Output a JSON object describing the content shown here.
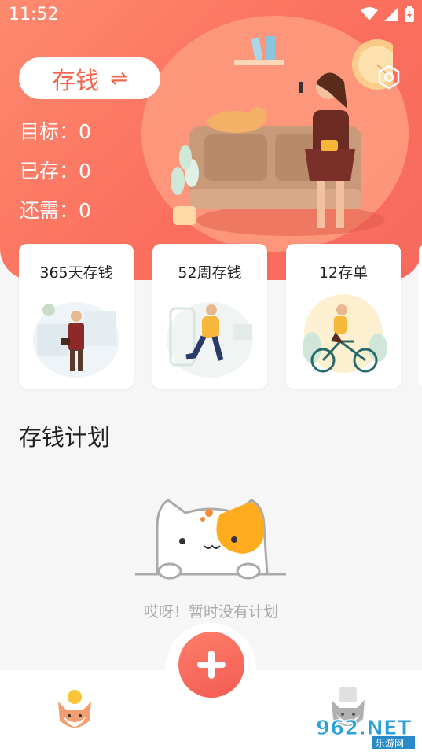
{
  "status_bar": {
    "time": "11:52"
  },
  "header": {
    "mode_label": "存钱",
    "mode_swap_icon": "swap-arrows-icon",
    "stats": [
      {
        "label": "目标：",
        "value": "0"
      },
      {
        "label": "已存：",
        "value": "0"
      },
      {
        "label": "还需：",
        "value": "0"
      }
    ]
  },
  "plan_cards": [
    {
      "label": "365天存钱"
    },
    {
      "label": "52周存钱"
    },
    {
      "label": "12存单"
    }
  ],
  "section": {
    "title": "存钱计划"
  },
  "empty_state": {
    "text": "哎呀！暂时没有计划"
  },
  "watermark": {
    "brand": "962.NET",
    "sub": "乐游网"
  },
  "colors": {
    "accent": "#f86a5f",
    "accent_light": "#fd8a6e",
    "text_muted": "#aaaaaa"
  }
}
